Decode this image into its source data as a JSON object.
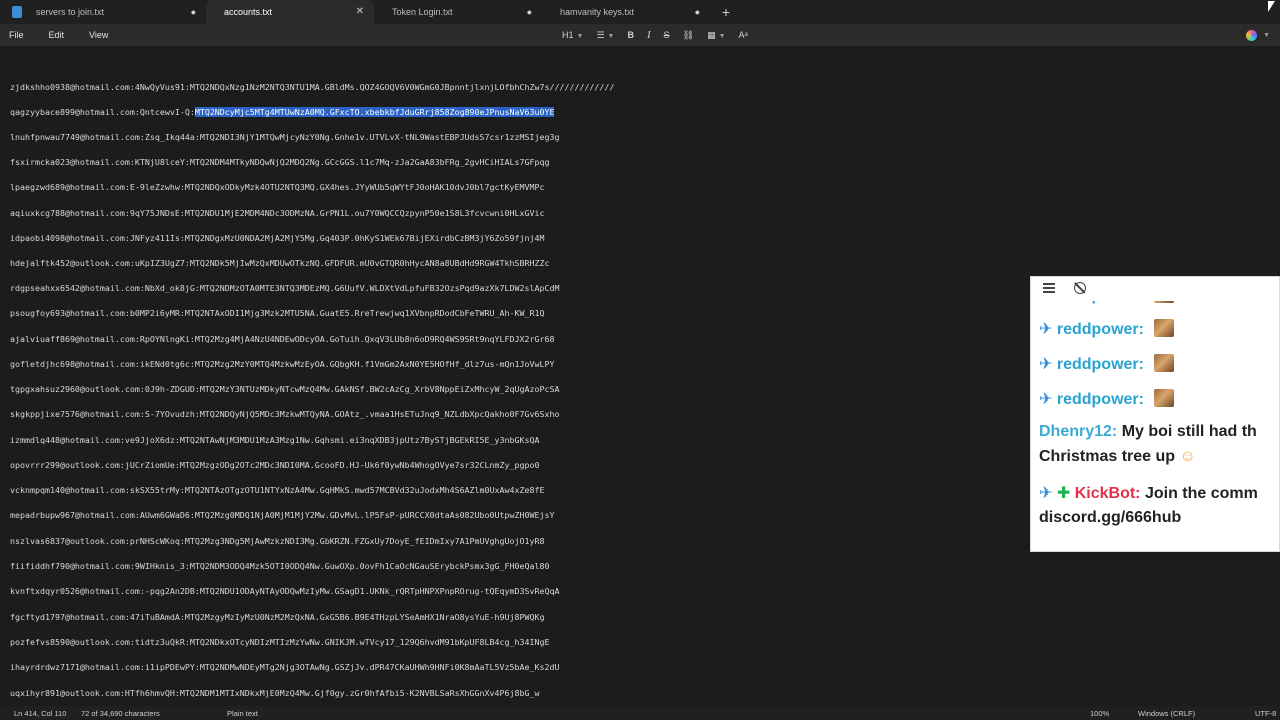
{
  "tabs": [
    {
      "label": "servers to join.txt",
      "control": "●"
    },
    {
      "label": "accounts.txt",
      "control": "✕"
    },
    {
      "label": "Token Login.txt",
      "control": "●"
    },
    {
      "label": "hamvanity keys.txt",
      "control": "●"
    }
  ],
  "new_tab_label": "+",
  "menu": {
    "file": "File",
    "edit": "Edit",
    "view": "View"
  },
  "toolbar": {
    "heading": "H1",
    "bold": "B",
    "italic": "I",
    "strike": "S",
    "link": "⛓",
    "table": "▦",
    "spell": "Aᵃ"
  },
  "editor": {
    "lines": [
      "zjdkshho0938@hotmail.com:4NwQyVus91:MTQ2NDQxNzg1NzM2NTQ3NTU1MA.GBldMs.QOZ4GOQV6V0WGmG0JBpnntjlxnjLOfbhChZw7s/////////////",
      "qagzyybace899@hotmail.com:QntcewvI-Q:",
      "lnuhfpnwau7749@hotmail.com:Zsq_Ikq44a:MTQ2NDI3NjY1MTQwMjcyNzY0Ng.Gnhe1v.UTVLvX-tNL9WastEBPJUdsS7csr1zzMSIjeg3g",
      "fsxirmcka023@hotmail.com:KTNjU8lceY:MTQ2NDM4MTkyNDQwNjQ2MDQ2Ng.GCcGGS.l1c7Mq-zJa2GaA83bFRg_2gvHCiHIALs7GFpqg",
      "lpaegzwd689@hotmail.com:E-9leZzwhw:MTQ2NDQxODkyMzk4OTU2NTQ3MQ.GX4hes.JYyWUb5qWYtFJ0oHAK10dvJ0bl7gctKyEMVMPc",
      "aqiuxkcg788@hotmail.com:9qY75JNDsE:MTQ2NDU1MjE2MDM4NDc3ODMzNA.GrPN1L.ou7Y0WQCCQzpynP50e1S8L3fcvcwni0HLxGVic",
      "idpaobi4098@hotmail.com:JNFyz411Is:MTQ2NDgxMzU0NDA2MjA2MjY5Mg.Gq403P.0hKyS1WEk67BijEXirdbCzBM3jY6Zo59fjnj4M",
      "hdejalftk452@outlook.com:uKpIZ3UgZ7:MTQ2NDk5MjIwMzQxMDUwOTkzNQ.GFDFUR.mU0vGTQR0hHycAN8a8UBdHd9RGW4TkhSBRHZZc",
      "rdgpseahxx6542@hotmail.com:NbXd_ok8jG:MTQ2NDMzOTA0MTE3NTQ3MDEzMQ.G6UufV.WLDXtVdLpfuFB32OzsPqd9azXk7LDW2slApCdM",
      "psougfoy693@hotmail.com:b0MP2i6yMR:MTQ2NTAxODI1Mjg3Mzk2MTU5NA.GuatE5.RreTrewjwq1XVbnpRDodCbFeTWRU_Ah-KW_R1Q",
      "ajalviuaff869@hotmail.com:RpOYNlngKi:MTQ2Mzg4MjA4NzU4NDEwODcyOA.GoTuih.QxqV3LUb8n6oD9RQ4WS9SRt9nqYLFDJX2rGr68",
      "gofletdjhc698@hotmail.com:ikENd0tg6c:MTQ2Mzg2MzY0MTQ4MzkwMzEyOA.GQbgKH.f1VmGm2AxN0YE5HOfHf_dlz7us-mQn1JoVwLPY",
      "tgpgxahsuz2960@outlook.com:0J9h-ZDGUD:MTQ2MzY3NTUzMDkyNTcwMzQ4Mw.GAkNSf.BW2cAzCg_XrbV8NppEiZxMhcyW_2qUgAzoPcSA",
      "skgkppjixe7576@hotmail.com:S-7YOvudzh:MTQ2NDQyNjQ5MDc3MzkwMTQyNA.GOAtz_.vmaa1HsETuJnq9_NZLdbXpcQakho0F7Gv6Sxho",
      "izmmdlq448@hotmail.com:ve9JjoX6dz:MTQ2NTAwNjM3MDU1MzA3Mzg1Nw.Gqhsmi.ei3nqXDB3jpUtz7BySTjBGEkRI5E_y3nbGKsQA",
      "opovrrr299@outlook.com:jUCrZiomUe:MTQ2MzgzODg2OTc2MDc3NDI0MA.GcooFD.HJ-Uk6f0ywNb4WhogOVye7sr32CLnmZy_pgpo0",
      "vcknmpqm140@hotmail.com:skSX55trMy:MTQ2NTAzOTgzOTU1NTYxNzA4Mw.GqHMkS.mwd57MCBVd32uJodxMh4S6AZlm0UxAw4xZe8fE",
      "mepadrbupw967@hotmail.com:AUwm6GWaD6:MTQ2Mzg0MDQ1NjA0MjM1MjY2Mw.GDvMvL.lP5FsP-pURCCX0dtaAs082Ubo0UtpwZH0WEjsY",
      "nszlvas6837@outlook.com:prNHScWKoq:MTQ2Mzg3NDg5MjAwMzkzNDI3Mg.GbKRZN.FZGxUy7DoyE_fEIDmIxy7A1PmUVghgUojO1yR8",
      "fiifiddhf790@hotmail.com:9WIHknis_3:MTQ2NDM3ODQ4Mzk5OTI0ODQ4Nw.GuwOXp.0ovFh1CaOcNGauSErybckPsmx3gG_FH0eQal80",
      "kvnftxdqyr0526@hotmail.com:-pqg2An2DB:MTQ2NDU1ODAyNTAyODQwMzIyMw.GSagD1.UKNk_rQRTpHNPXPnpROrug-tQEqymD3SvReQqA",
      "fgcftyd1797@hotmail.com:47iTuBAmdA:MTQ2MzgyMzIyMzU0NzM2MzQxNA.GxG5B6.B9E4THzpLYSeAmHX1NraO8ysYuE-h9Uj8PWQKg",
      "pozfefvs8590@outlook.com:tidtz3uQkR:MTQ2NDkxOTcyNDIzMTIzMzYwNw.GNIKJM.wTVcy17_129Q6hvdM91bKpUF8LB4cg_h34INgE",
      "ihayrdrdwz7171@hotmail.com:i1ipPDEwPY:MTQ2NDMwNDEyMTg2Njg3OTAwNg.GSZjJv.dPR47CKaUHWh9HNFi0K8mAaTL5Vz5bAe_Ks2dU",
      "uqxihyr891@outlook.com:HTfh6hmvQH:MTQ2NDM1MTIxNDkxMjE0MzQ4Mw.Gjf0gy.zGr0hfAfbi5-K2NVBLSaRsXhGGnXv4P6j8bG_w"
    ],
    "selected_text": "MTQ2NDcyMjc5MTg4MTUwNzA0MQ.GFxcTO.xbebkbfJduGRrj858Zog890eJPnusNaV63u0YE"
  },
  "status": {
    "position": "Ln 414, Col 110",
    "selection": "72 of 34,690 characters",
    "mode": "Plain text",
    "zoom": "100%",
    "line_ending": "Windows (CRLF)",
    "encoding": "UTF-8"
  },
  "chat": {
    "top_partial": "reddpower:",
    "messages": [
      {
        "user": "reddpower:"
      },
      {
        "user": "reddpower:"
      },
      {
        "user": "reddpower:"
      }
    ],
    "dhenry": {
      "user": "Dhenry12:",
      "text1": "My boi still had th",
      "text2": "Christmas tree up"
    },
    "kickbot": {
      "user": "KickBot:",
      "text1": "Join the comm",
      "text2": "discord.gg/666hub"
    }
  }
}
